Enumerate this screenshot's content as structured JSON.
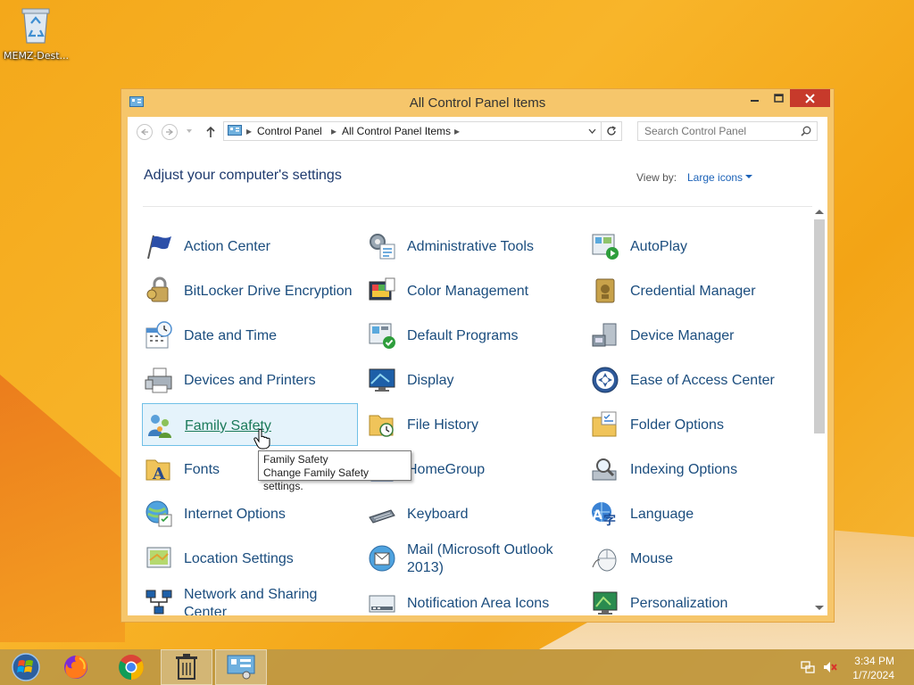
{
  "desktop": {
    "icons": [
      {
        "label": "MEMZ-Dest...",
        "icon": "recycle-bin-icon"
      }
    ]
  },
  "window": {
    "title": "All Control Panel Items",
    "address": {
      "crumbs": [
        "Control Panel",
        "All Control Panel Items"
      ]
    },
    "search_placeholder": "Search Control Panel",
    "heading": "Adjust your computer's settings",
    "view_by_label": "View by:",
    "view_by_value": "Large icons",
    "items": [
      {
        "label": "Action Center",
        "icon": "flag-icon"
      },
      {
        "label": "Administrative Tools",
        "icon": "admin-tools-icon"
      },
      {
        "label": "AutoPlay",
        "icon": "autoplay-icon"
      },
      {
        "label": "BitLocker Drive Encryption",
        "icon": "bitlocker-icon"
      },
      {
        "label": "Color Management",
        "icon": "color-management-icon"
      },
      {
        "label": "Credential Manager",
        "icon": "credential-manager-icon"
      },
      {
        "label": "Date and Time",
        "icon": "calendar-clock-icon"
      },
      {
        "label": "Default Programs",
        "icon": "default-programs-icon"
      },
      {
        "label": "Device Manager",
        "icon": "device-manager-icon"
      },
      {
        "label": "Devices and Printers",
        "icon": "printer-icon"
      },
      {
        "label": "Display",
        "icon": "monitor-icon"
      },
      {
        "label": "Ease of Access Center",
        "icon": "ease-of-access-icon"
      },
      {
        "label": "Family Safety",
        "icon": "family-safety-icon"
      },
      {
        "label": "File History",
        "icon": "file-history-icon"
      },
      {
        "label": "Folder Options",
        "icon": "folder-options-icon"
      },
      {
        "label": "Fonts",
        "icon": "fonts-icon"
      },
      {
        "label": "HomeGroup",
        "icon": "homegroup-icon"
      },
      {
        "label": "Indexing Options",
        "icon": "indexing-icon"
      },
      {
        "label": "Internet Options",
        "icon": "internet-options-icon"
      },
      {
        "label": "Keyboard",
        "icon": "keyboard-icon"
      },
      {
        "label": "Language",
        "icon": "language-icon"
      },
      {
        "label": "Location Settings",
        "icon": "location-icon"
      },
      {
        "label": "Mail (Microsoft Outlook 2013)",
        "icon": "mail-icon"
      },
      {
        "label": "Mouse",
        "icon": "mouse-icon"
      },
      {
        "label": "Network and Sharing Center",
        "icon": "network-icon"
      },
      {
        "label": "Notification Area Icons",
        "icon": "notification-area-icon"
      },
      {
        "label": "Personalization",
        "icon": "personalization-icon"
      }
    ],
    "hovered_item": "Family Safety",
    "tooltip": {
      "title": "Family Safety",
      "description": "Change Family Safety settings."
    }
  },
  "taskbar": {
    "apps": [
      "start-icon",
      "firefox-icon",
      "chrome-icon",
      "recycle-bin-icon",
      "control-panel-icon"
    ],
    "clock": {
      "time": "3:34 PM",
      "date": "1/7/2024"
    }
  },
  "colors": {
    "link": "#1b4d7e",
    "accent": "#f6c66b",
    "close": "#c73a2b"
  }
}
